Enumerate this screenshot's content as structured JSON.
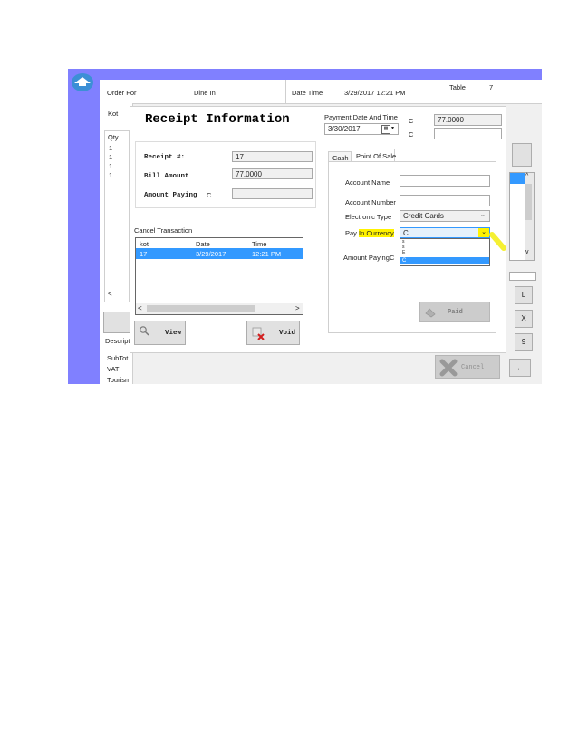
{
  "header": {
    "order_for_label": "Order For",
    "order_type": "Dine In",
    "date_time_label": "Date Time",
    "date_time_value": "3/29/2017 12:21 PM",
    "table_label": "Table",
    "table_value": "7"
  },
  "background": {
    "kot_label": "Kot",
    "qty_label": "Qty",
    "qty_values": [
      "1",
      "1",
      "1",
      "1"
    ],
    "description_label": "Descripti",
    "subtotal_label": "SubTot",
    "vat_label": "VAT",
    "tourism_label": "Tourism",
    "keypad": [
      "L",
      "X",
      "9",
      "←"
    ],
    "cancel_label": "Cancel"
  },
  "dialog": {
    "title": "Receipt Information",
    "receipt_label": "Receipt #:",
    "receipt_value": "17",
    "bill_label": "Bill Amount",
    "bill_value": "77.0000",
    "amount_paying_label": "Amount Paying",
    "amount_paying_currency": "C",
    "amount_paying_value": "",
    "cancel_transaction": {
      "title": "Cancel Transaction",
      "columns": [
        "kot",
        "Date",
        "Time"
      ],
      "rows": [
        [
          "17",
          "3/29/2017",
          "12:21 PM"
        ]
      ]
    },
    "view_label": "View",
    "void_label": "Void",
    "payment_date": {
      "label": "Payment Date And Time",
      "value": "3/30/2017",
      "currency_1": "C",
      "amount_1": "77.0000",
      "currency_2": "C",
      "amount_2": ""
    },
    "tabs": [
      "Cash",
      "Point Of Sale"
    ],
    "pos": {
      "account_name_label": "Account Name",
      "account_number_label": "Account Number",
      "electronic_type_label": "Electronic Type",
      "electronic_type_value": "Credit Cards",
      "pay_in_currency_label_1": "Pay",
      "pay_in_currency_label_2": "In Currency",
      "currency_value": "C",
      "currency_options": [
        "s",
        "s",
        "E",
        "C"
      ],
      "amount_paying_label": "Amount Paying",
      "amount_paying_currency": "C",
      "paid_label": "Paid"
    }
  },
  "colors": {
    "accent_purple": "#8080ff",
    "selection_blue": "#3399ff",
    "highlight_yellow": "#fff200"
  }
}
